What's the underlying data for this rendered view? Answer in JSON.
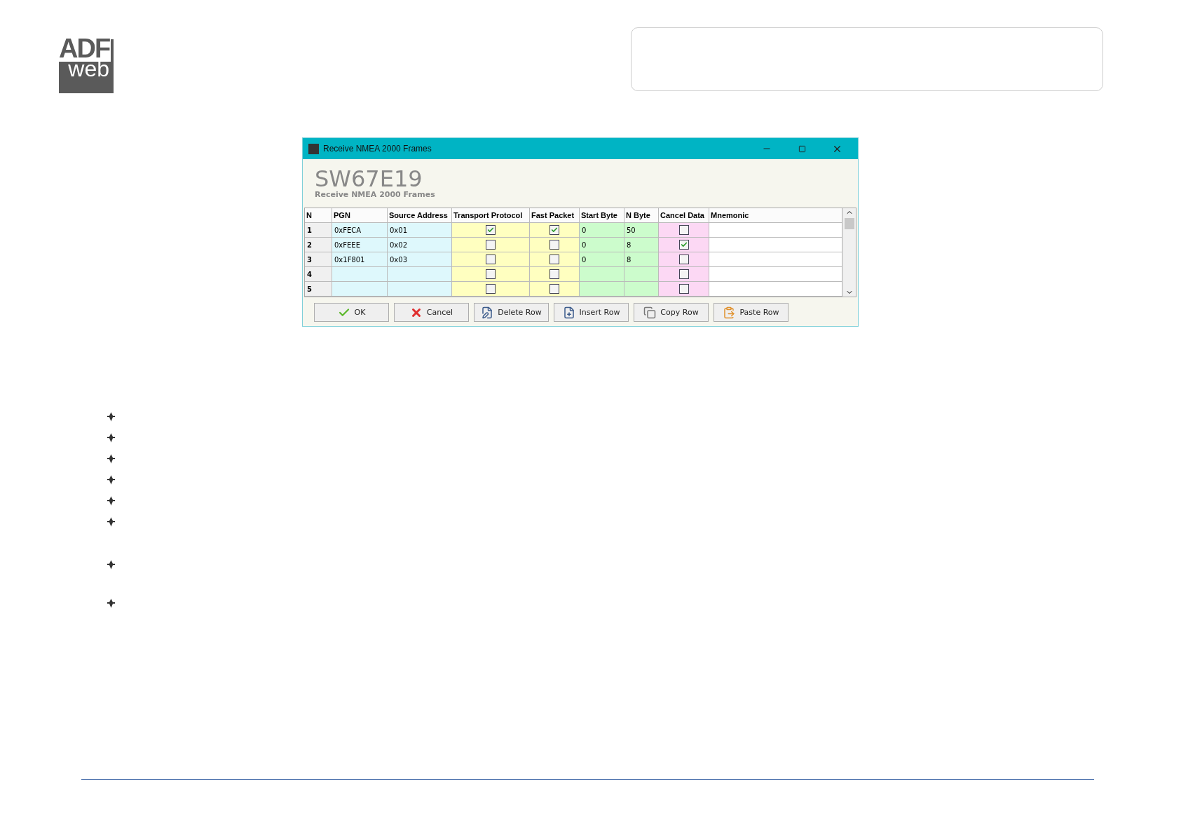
{
  "logo": {
    "top": "ADF",
    "bottom": "web"
  },
  "dialog": {
    "title": "Receive NMEA 2000 Frames",
    "heading": "SW67E19",
    "subheading": "Receive NMEA 2000 Frames",
    "table": {
      "columns": [
        {
          "label": "N",
          "kind": "index",
          "color": "#f0f0f0"
        },
        {
          "label": "PGN",
          "kind": "text",
          "color": "#def8fc"
        },
        {
          "label": "Source Address",
          "kind": "text",
          "color": "#def8fc"
        },
        {
          "label": "Transport Protocol",
          "kind": "check",
          "color": "#ffffc0"
        },
        {
          "label": "Fast Packet",
          "kind": "check",
          "color": "#ffffc0"
        },
        {
          "label": "Start Byte",
          "kind": "text",
          "color": "#ccfccc"
        },
        {
          "label": "N Byte",
          "kind": "text",
          "color": "#ccfccc"
        },
        {
          "label": "Cancel Data",
          "kind": "check",
          "color": "#fcd8f4"
        },
        {
          "label": "Mnemonic",
          "kind": "text",
          "color": "#ffffff"
        }
      ],
      "rows": [
        {
          "cells": [
            "1",
            "0xFECA",
            "0x01",
            true,
            true,
            "0",
            "50",
            false,
            null
          ]
        },
        {
          "cells": [
            "2",
            "0xFEEE",
            "0x02",
            false,
            false,
            "0",
            "8",
            true,
            null
          ]
        },
        {
          "cells": [
            "3",
            "0x1F801",
            "0x03",
            false,
            false,
            "0",
            "8",
            false,
            null
          ]
        },
        {
          "cells": [
            "4",
            null,
            null,
            false,
            false,
            null,
            null,
            false,
            null
          ]
        },
        {
          "cells": [
            "5",
            null,
            null,
            false,
            false,
            null,
            null,
            false,
            null
          ]
        }
      ]
    },
    "buttons": [
      {
        "label": "OK",
        "kind": "ok"
      },
      {
        "label": "Cancel",
        "kind": "cancel"
      },
      {
        "label": "Delete Row",
        "kind": "delete"
      },
      {
        "label": "Insert Row",
        "kind": "insert"
      },
      {
        "label": "Copy Row",
        "kind": "copy"
      },
      {
        "label": "Paste Row",
        "kind": "paste"
      }
    ]
  }
}
